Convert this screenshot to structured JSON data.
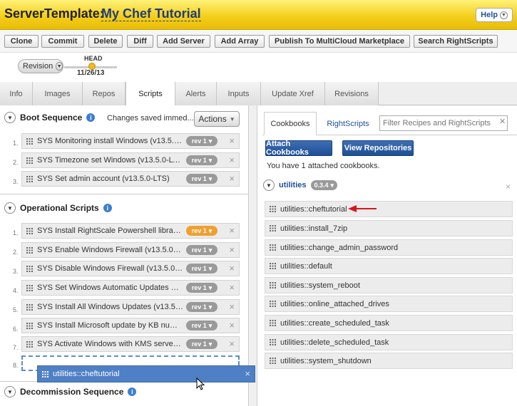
{
  "title": {
    "prefix": "ServerTemplate:",
    "name": "My Chef Tutorial",
    "help": "Help"
  },
  "toolbar": [
    "Clone",
    "Commit",
    "Delete",
    "Diff",
    "Add Server",
    "Add Array",
    "Publish To MultiCloud Marketplace",
    "Search RightScripts"
  ],
  "revision": {
    "label": "Revision",
    "head": "HEAD",
    "date": "11/26/13"
  },
  "tabs": [
    "Info",
    "Images",
    "Repos",
    "Scripts",
    "Alerts",
    "Inputs",
    "Update Xref",
    "Revisions"
  ],
  "active_tab": "Scripts",
  "boot": {
    "title": "Boot Sequence",
    "saved": "Changes saved immed...",
    "actions": "Actions",
    "items": [
      {
        "num": "1.",
        "name": "SYS Monitoring install Windows (v13.5.0-L...",
        "rev": "rev 1"
      },
      {
        "num": "2.",
        "name": "SYS Timezone set Windows (v13.5.0-LTS)",
        "rev": "rev 1"
      },
      {
        "num": "3.",
        "name": "SYS Set admin account (v13.5.0-LTS)",
        "rev": "rev 1"
      }
    ]
  },
  "operational": {
    "title": "Operational Scripts",
    "items": [
      {
        "num": "1.",
        "name": "SYS Install RightScale Powershell library (...",
        "rev": "rev 1",
        "highlight": true
      },
      {
        "num": "2.",
        "name": "SYS Enable Windows Firewall (v13.5.0-LTS)",
        "rev": "rev 1",
        "highlight": false
      },
      {
        "num": "3.",
        "name": "SYS Disable Windows Firewall (v13.5.0-LTS)",
        "rev": "rev 1",
        "highlight": false
      },
      {
        "num": "4.",
        "name": "SYS Set Windows Automatic Updates Poli...",
        "rev": "rev 1",
        "highlight": false
      },
      {
        "num": "5.",
        "name": "SYS Install All Windows Updates (v13.5.0-...",
        "rev": "rev 1",
        "highlight": false
      },
      {
        "num": "6.",
        "name": "SYS Install Microsoft update by KB number...",
        "rev": "rev 1",
        "highlight": false
      },
      {
        "num": "7.",
        "name": "SYS Activate Windows with KMS server (v1...",
        "rev": "rev 1",
        "highlight": false
      }
    ],
    "drop_num": "8.",
    "dragging": "utilities::cheftutorial"
  },
  "decommission": {
    "title": "Decommission Sequence"
  },
  "right": {
    "tabs": [
      "Cookbooks",
      "RightScripts"
    ],
    "filter_placeholder": "Filter Recipes and RightScripts",
    "attach": "Attach Cookbooks",
    "view": "View Repositories",
    "count": "You have 1 attached cookbooks.",
    "cookbook": {
      "name": "utilities",
      "version": "0.3.4"
    },
    "recipes": [
      "utilities::cheftutorial",
      "utilities::install_7zip",
      "utilities::change_admin_password",
      "utilities::default",
      "utilities::system_reboot",
      "utilities::online_attached_drives",
      "utilities::create_scheduled_task",
      "utilities::delete_scheduled_task",
      "utilities::system_shutdown"
    ]
  },
  "colors": {
    "title_bar": "#f4cf1c",
    "link_blue": "#1f5199",
    "button_blue": "#2a5ea5",
    "arrow_red": "#d9141c",
    "rev_orange": "#f0a030"
  }
}
